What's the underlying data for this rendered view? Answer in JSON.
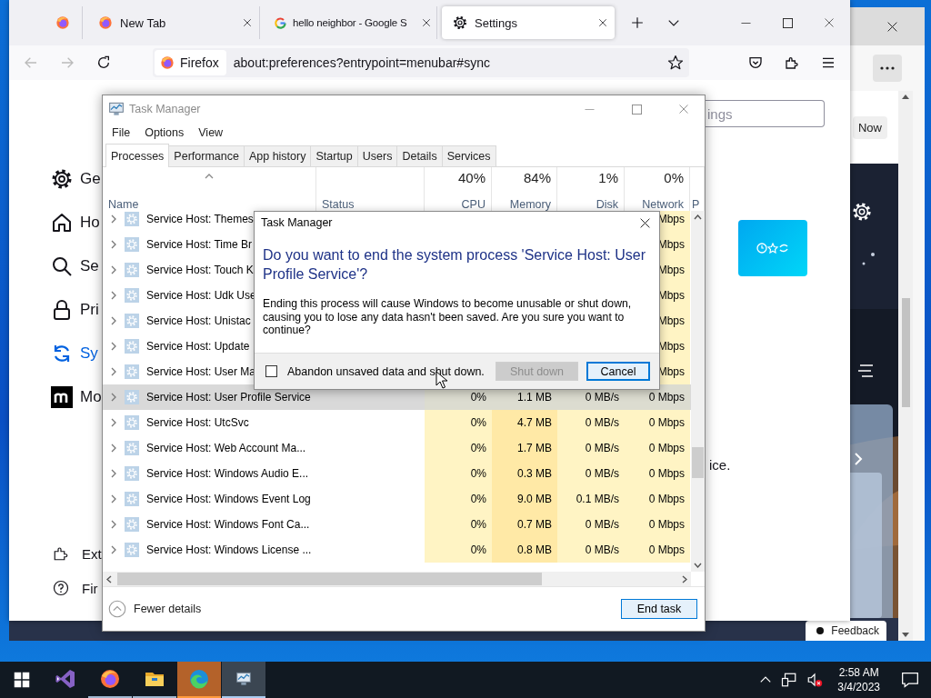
{
  "edge_window": {
    "now_button": "Now",
    "feedback_button": "Feedback"
  },
  "firefox": {
    "tabs": [
      {
        "kind": "pinned",
        "selected": false
      },
      {
        "kind": "firefox",
        "title": "New Tab",
        "selected": false
      },
      {
        "kind": "google",
        "title": "hello neighbor - Google S",
        "selected": false
      },
      {
        "kind": "settings",
        "title": "Settings",
        "selected": true
      }
    ],
    "identity": "Firefox",
    "address": "about:preferences?entrypoint=menubar#sync",
    "sidebar": [
      {
        "kind": "general",
        "label": "Ge",
        "selected": false
      },
      {
        "kind": "home",
        "label": "Ho",
        "selected": false
      },
      {
        "kind": "search",
        "label": "Se",
        "selected": false
      },
      {
        "kind": "privacy",
        "label": "Pri",
        "selected": false
      },
      {
        "kind": "sync",
        "label": "Sy",
        "selected": true
      },
      {
        "kind": "mozilla",
        "label": "Mo",
        "selected": false
      }
    ],
    "sidebar_footer": [
      {
        "kind": "extensions",
        "label": "Ext"
      },
      {
        "kind": "help",
        "label": "Fir"
      }
    ],
    "search": {
      "placeholder": "ings"
    },
    "text": "ice."
  },
  "task_manager": {
    "title": "Task Manager",
    "menu": [
      "File",
      "Options",
      "View"
    ],
    "tabs": [
      {
        "label": "Processes",
        "selected": true
      },
      {
        "label": "Performance",
        "selected": false
      },
      {
        "label": "App history",
        "selected": false
      },
      {
        "label": "Startup",
        "selected": false
      },
      {
        "label": "Users",
        "selected": false
      },
      {
        "label": "Details",
        "selected": false
      },
      {
        "label": "Services",
        "selected": false
      }
    ],
    "columns": [
      {
        "label": "Name",
        "sorted": true
      },
      {
        "label": "Status",
        "sorted": false
      },
      {
        "label": "CPU",
        "usage": "40%",
        "sorted": false
      },
      {
        "label": "Memory",
        "usage": "84%",
        "sorted": false
      },
      {
        "label": "Disk",
        "usage": "1%",
        "sorted": false
      },
      {
        "label": "Network",
        "usage": "0%",
        "sorted": false
      },
      {
        "label": "P",
        "sorted": false
      }
    ],
    "rows": [
      {
        "name": "Service Host: Themes",
        "network": "Mbps",
        "selected": false
      },
      {
        "name": "Service Host: Time Br",
        "network": "Mbps",
        "selected": false
      },
      {
        "name": "Service Host: Touch K",
        "network": "Mbps",
        "selected": false
      },
      {
        "name": "Service Host: Udk Use",
        "network": "Mbps",
        "selected": false
      },
      {
        "name": "Service Host: Unistac",
        "network": "Mbps",
        "selected": false
      },
      {
        "name": "Service Host: Update",
        "network": "Mbps",
        "selected": false
      },
      {
        "name": "Service Host: User Ma",
        "network": "Mbps",
        "selected": false
      },
      {
        "name": "Service Host: User Profile Service",
        "cpu": "0%",
        "memory": "1.1 MB",
        "disk": "0 MB/s",
        "network": "0 Mbps",
        "selected": true
      },
      {
        "name": "Service Host: UtcSvc",
        "cpu": "0%",
        "memory": "4.7 MB",
        "disk": "0 MB/s",
        "network": "0 Mbps",
        "selected": false
      },
      {
        "name": "Service Host: Web Account Ma...",
        "cpu": "0%",
        "memory": "1.7 MB",
        "disk": "0 MB/s",
        "network": "0 Mbps",
        "selected": false
      },
      {
        "name": "Service Host: Windows Audio E...",
        "cpu": "0%",
        "memory": "0.3 MB",
        "disk": "0 MB/s",
        "network": "0 Mbps",
        "selected": false
      },
      {
        "name": "Service Host: Windows Event Log",
        "cpu": "0%",
        "memory": "9.0 MB",
        "disk": "0.1 MB/s",
        "network": "0 Mbps",
        "selected": false
      },
      {
        "name": "Service Host: Windows Font Ca...",
        "cpu": "0%",
        "memory": "0.7 MB",
        "disk": "0 MB/s",
        "network": "0 Mbps",
        "selected": false
      },
      {
        "name": "Service Host: Windows License ...",
        "cpu": "0%",
        "memory": "0.8 MB",
        "disk": "0 MB/s",
        "network": "0 Mbps",
        "selected": false
      }
    ],
    "fewer_details": "Fewer details",
    "end_task": "End task"
  },
  "dialog": {
    "title": "Task Manager",
    "heading": "Do you want to end the system process 'Service Host: User Profile Service'?",
    "message": "Ending this process will cause Windows to become unusable or shut down, causing you to lose any data hasn't been saved. Are you sure you want to continue?",
    "checkbox": {
      "label": "Abandon unsaved data and shut down.",
      "checked": false
    },
    "buttons": [
      {
        "label": "Shut down",
        "disabled": true,
        "focused": false
      },
      {
        "label": "Cancel",
        "disabled": false,
        "focused": true
      }
    ]
  },
  "taskbar": {
    "apps": [
      {
        "kind": "visual-studio",
        "running": false,
        "flashing": false,
        "selected": false
      },
      {
        "kind": "firefox",
        "running": true,
        "flashing": false,
        "selected": false
      },
      {
        "kind": "explorer",
        "running": true,
        "flashing": false,
        "selected": false
      },
      {
        "kind": "edge",
        "running": true,
        "flashing": true,
        "selected": false
      },
      {
        "kind": "task-manager",
        "running": true,
        "flashing": false,
        "selected": true
      }
    ],
    "volume_muted": true,
    "clock": {
      "time": "2:58 AM",
      "date": "3/4/2023"
    }
  }
}
